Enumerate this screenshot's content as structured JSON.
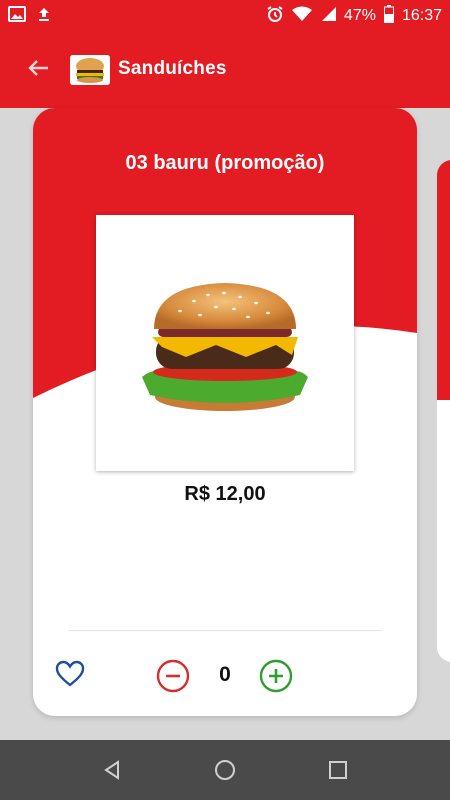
{
  "status_bar": {
    "battery_percent": "47%",
    "time": "16:37",
    "icons": [
      "gallery-icon",
      "upload-icon",
      "alarm-icon",
      "wifi-icon",
      "signal-icon",
      "battery-icon"
    ]
  },
  "header": {
    "title": "Sanduíches",
    "icons": [
      "back-arrow-icon",
      "category-avatar"
    ]
  },
  "product": {
    "name": "03 bauru (promoção)",
    "price": "R$ 12,00",
    "quantity": "0",
    "image": "burger-image"
  },
  "actions": {
    "favorite_icon": "heart-icon",
    "decrease_icon": "minus-circle-icon",
    "increase_icon": "plus-circle-icon"
  },
  "nav_bar": {
    "icons": [
      "back-triangle-icon",
      "home-circle-icon",
      "recents-square-icon"
    ]
  },
  "colors": {
    "brand_red": "#e31b23",
    "minus_red": "#d32f2f",
    "plus_green": "#2e9e2e",
    "heart_blue": "#1f4e9c"
  }
}
